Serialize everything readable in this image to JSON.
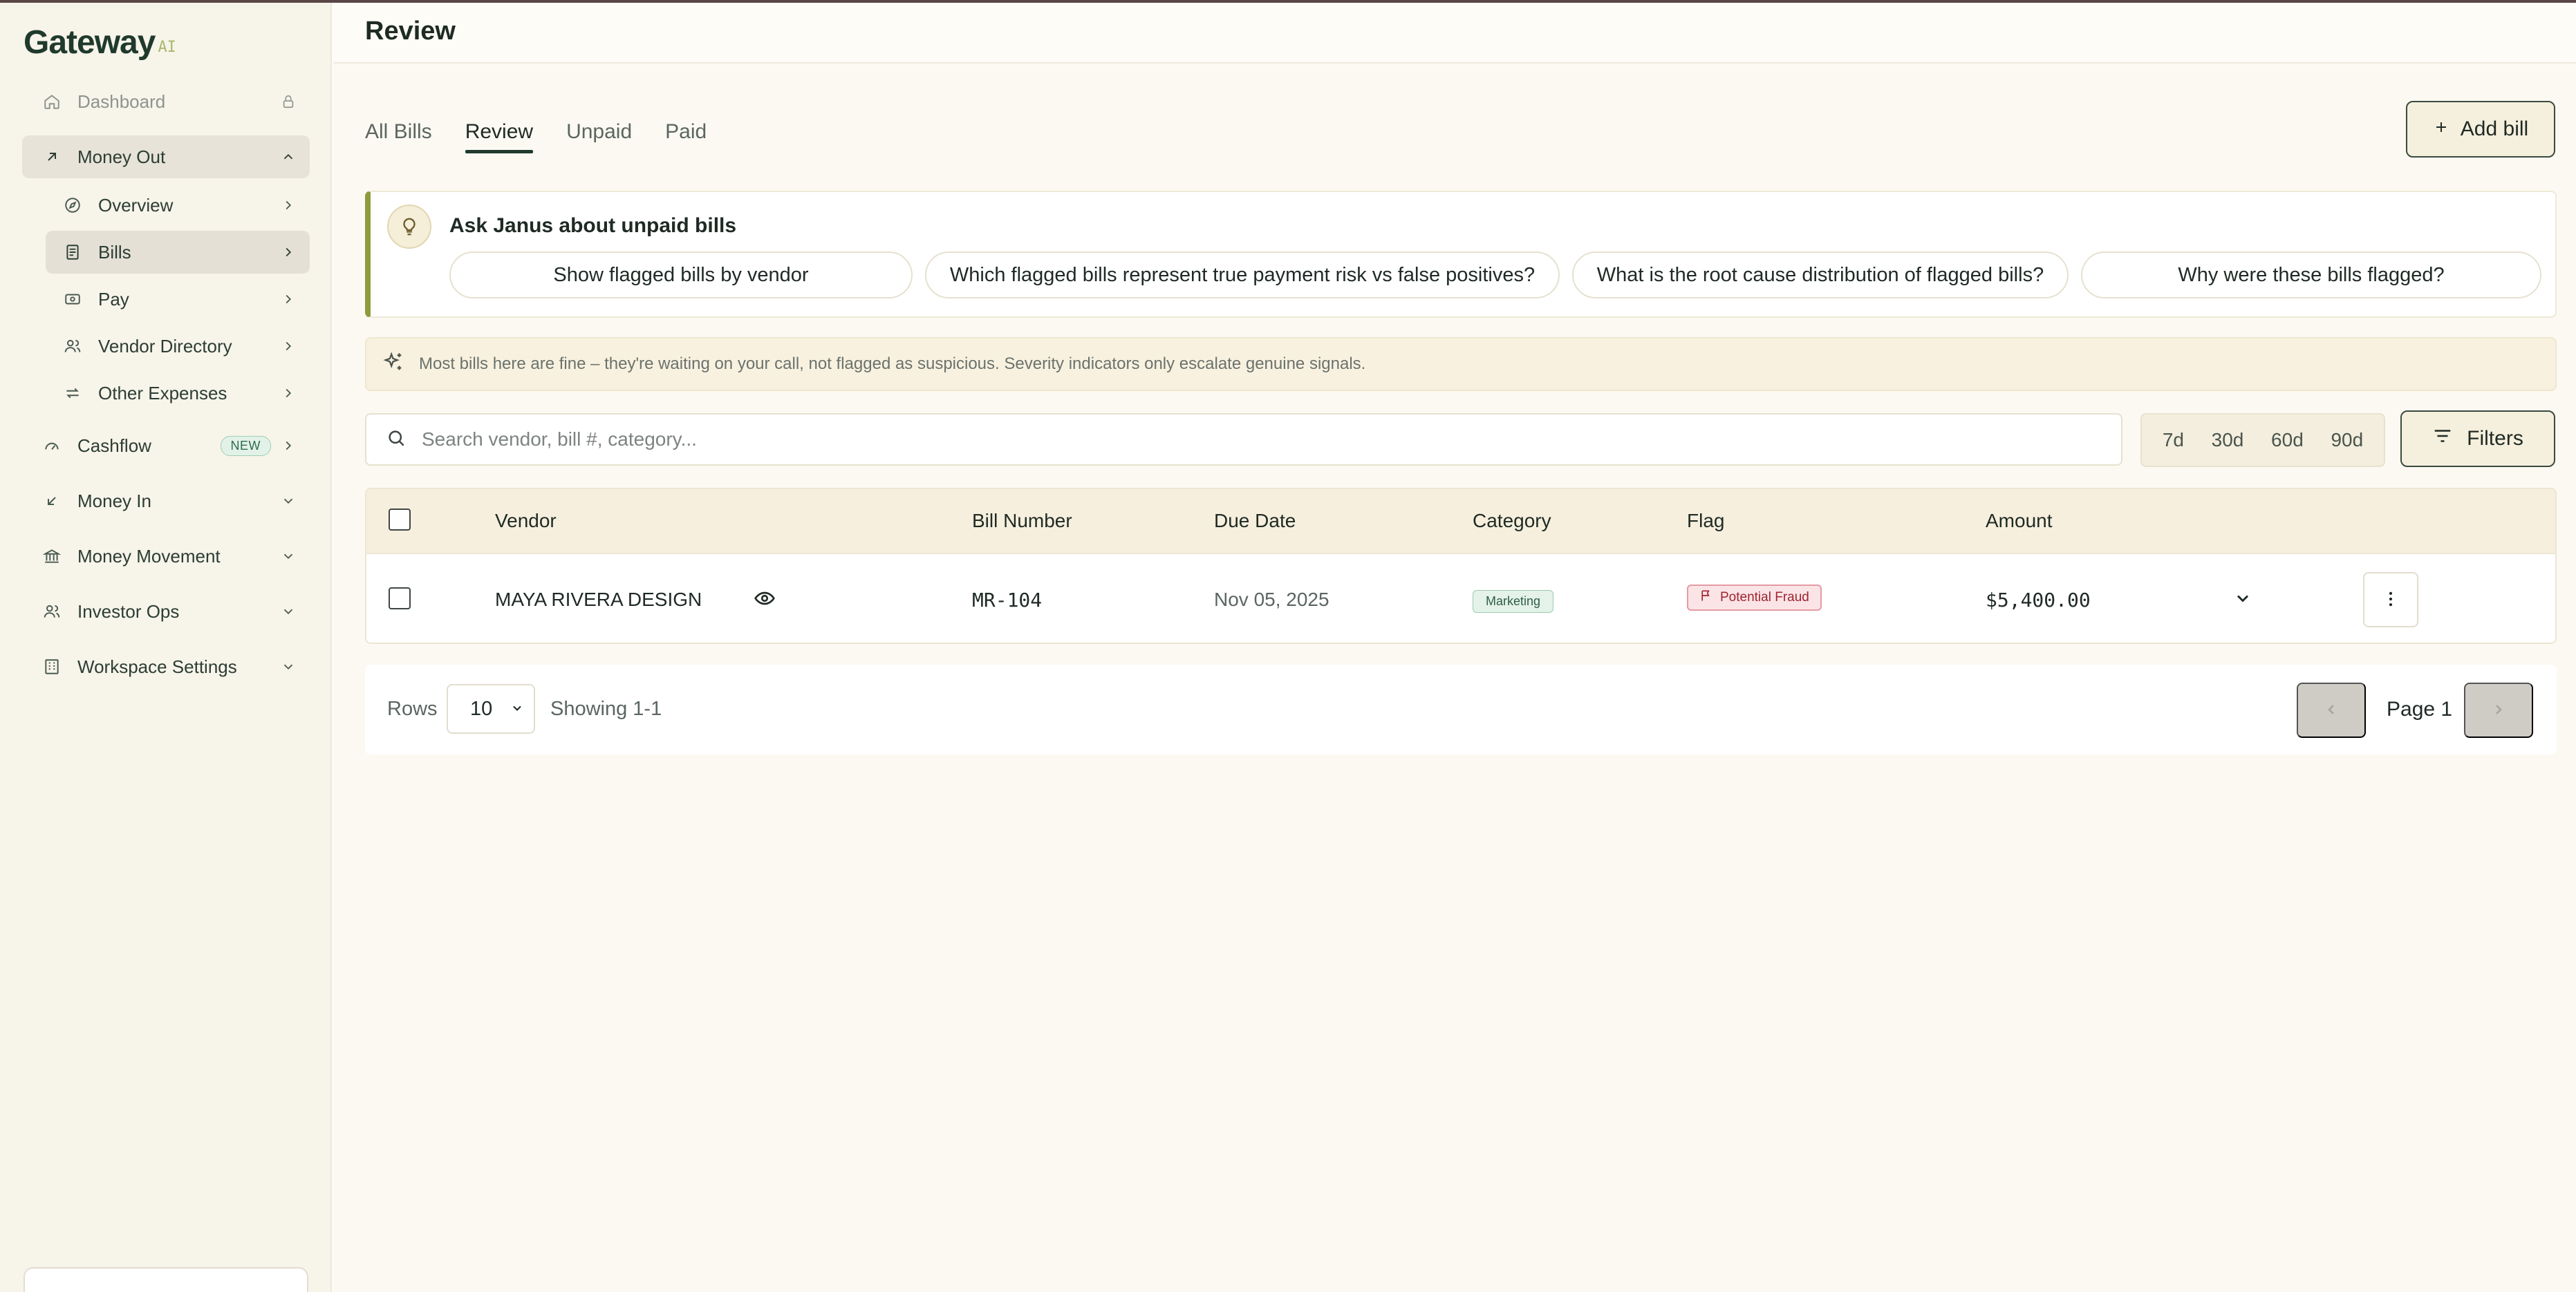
{
  "app": {
    "name": "Gateway",
    "name_suffix": "AI"
  },
  "sidebar": {
    "dashboard": {
      "label": "Dashboard",
      "icon": "home-icon",
      "trailing_icon": "lock-icon"
    },
    "money_out": {
      "label": "Money Out",
      "icon": "arrow-up-right-icon",
      "expanded": true,
      "children": [
        {
          "label": "Overview",
          "icon": "compass-icon"
        },
        {
          "label": "Bills",
          "icon": "receipt-icon",
          "active": true
        },
        {
          "label": "Pay",
          "icon": "cash-icon"
        },
        {
          "label": "Vendor Directory",
          "icon": "users-icon"
        },
        {
          "label": "Other Expenses",
          "icon": "repeat-icon"
        }
      ]
    },
    "cashflow": {
      "label": "Cashflow",
      "badge": "NEW",
      "icon": "gauge-icon"
    },
    "money_in": {
      "label": "Money In",
      "icon": "arrow-down-left-icon"
    },
    "money_movement": {
      "label": "Money Movement",
      "icon": "bank-icon"
    },
    "investor_ops": {
      "label": "Investor Ops",
      "icon": "users-icon"
    },
    "workspace_settings": {
      "label": "Workspace Settings",
      "icon": "building-icon"
    }
  },
  "header": {
    "title": "Review"
  },
  "tabs": [
    {
      "label": "All Bills",
      "active": false
    },
    {
      "label": "Review",
      "active": true
    },
    {
      "label": "Unpaid",
      "active": false
    },
    {
      "label": "Paid",
      "active": false
    }
  ],
  "add_bill_label": "Add bill",
  "ask": {
    "title": "Ask Janus about unpaid bills",
    "suggestions": [
      "Show flagged bills by vendor",
      "Which flagged bills represent true payment risk vs false positives?",
      "What is the root cause distribution of flagged bills?",
      "Why were these bills flagged?"
    ]
  },
  "note": "Most bills here are fine – they're waiting on your call, not flagged as suspicious. Severity indicators only escalate genuine signals.",
  "search": {
    "placeholder": "Search vendor, bill #, category...",
    "value": ""
  },
  "ranges": [
    "7d",
    "30d",
    "60d",
    "90d"
  ],
  "filters_label": "Filters",
  "table": {
    "columns": [
      "Vendor",
      "Bill Number",
      "Due Date",
      "Category",
      "Flag",
      "Amount"
    ],
    "rows": [
      {
        "vendor": "MAYA RIVERA DESIGN",
        "bill_number": "MR-104",
        "due_date": "Nov 05, 2025",
        "category": "Marketing",
        "flag": "Potential Fraud",
        "amount": "$5,400.00"
      }
    ]
  },
  "pagination": {
    "rows_label": "Rows",
    "rows_value": "10",
    "showing": "Showing 1-1",
    "page_label": "Page 1"
  },
  "colors": {
    "accent": "#1f3a2c",
    "ask_border": "#8e9b3c",
    "flag_red": "#9e2430",
    "category_green": "#2f5d47"
  }
}
